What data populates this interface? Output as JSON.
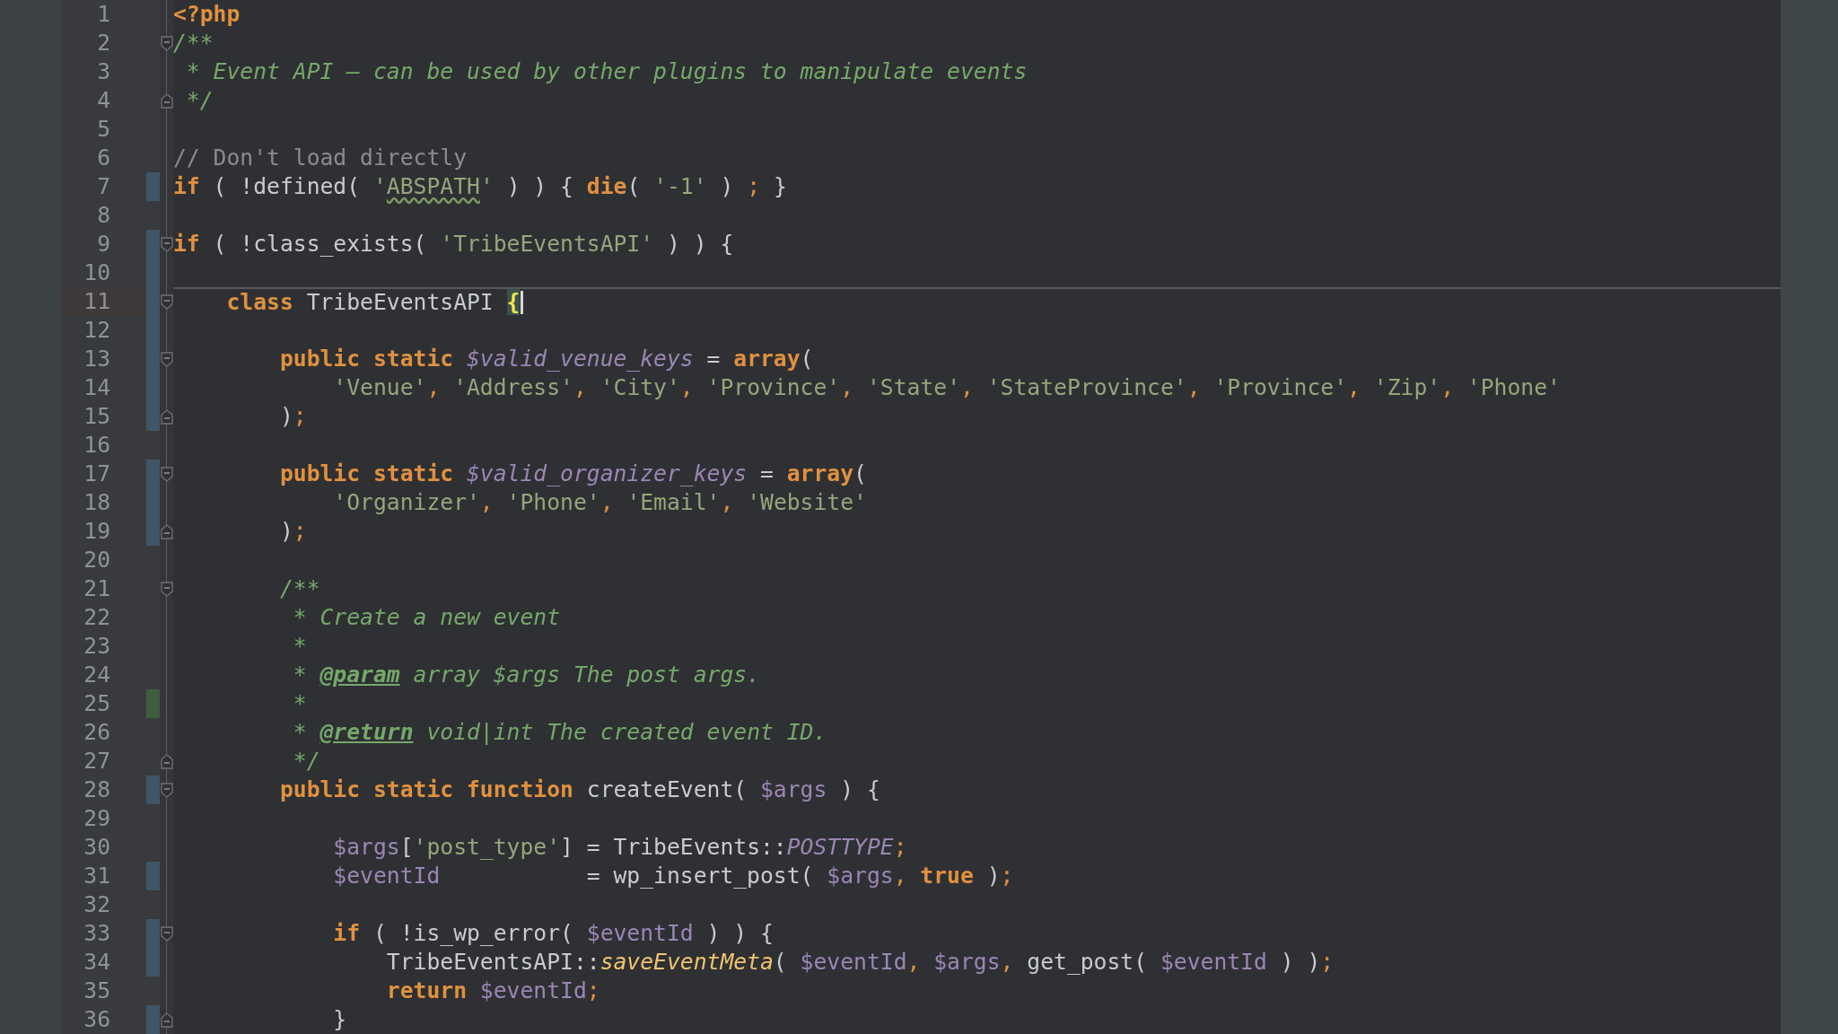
{
  "editor": {
    "lines": [
      {
        "number": "1",
        "tokens": [
          {
            "kind": "kw",
            "text": "<?php"
          }
        ]
      },
      {
        "number": "2",
        "fold_start": true,
        "tokens": [
          {
            "kind": "doc",
            "text": "/**"
          }
        ]
      },
      {
        "number": "3",
        "tokens": [
          {
            "kind": "doc",
            "text": " * Event API – can be used by other plugins to manipulate events"
          }
        ]
      },
      {
        "number": "4",
        "fold_end": true,
        "tokens": [
          {
            "kind": "doc",
            "text": " */"
          }
        ]
      },
      {
        "number": "5"
      },
      {
        "number": "6",
        "tokens": [
          {
            "kind": "comment",
            "text": "// Don't load directly"
          }
        ]
      },
      {
        "number": "7",
        "modified": true,
        "tokens": [
          {
            "kind": "kw",
            "text": "if"
          },
          {
            "kind": "text",
            "text": " ( !defined( "
          },
          {
            "kind": "str",
            "text": "'"
          },
          {
            "kind": "strwarn",
            "text": "ABSPATH"
          },
          {
            "kind": "str",
            "text": "'"
          },
          {
            "kind": "text",
            "text": " ) ) { "
          },
          {
            "kind": "kw",
            "text": "die"
          },
          {
            "kind": "text",
            "text": "( "
          },
          {
            "kind": "str",
            "text": "'-1'"
          },
          {
            "kind": "text",
            "text": " ) "
          },
          {
            "kind": "punct",
            "text": ";"
          },
          {
            "kind": "text",
            "text": " }"
          }
        ]
      },
      {
        "number": "8"
      },
      {
        "number": "9",
        "modified": true,
        "fold_start": true,
        "tokens": [
          {
            "kind": "kw",
            "text": "if"
          },
          {
            "kind": "text",
            "text": " ( !class_exists( "
          },
          {
            "kind": "str",
            "text": "'TribeEventsAPI'"
          },
          {
            "kind": "text",
            "text": " ) ) {"
          }
        ]
      },
      {
        "number": "10",
        "modified": true
      },
      {
        "number": "11",
        "modified": true,
        "fold_start": true,
        "current": true,
        "tokens": [
          {
            "kind": "kw",
            "text": "    class"
          },
          {
            "kind": "text",
            "text": " TribeEventsAPI "
          },
          {
            "kind": "brace",
            "text": "{"
          }
        ]
      },
      {
        "number": "12",
        "modified": true
      },
      {
        "number": "13",
        "modified": true,
        "fold_start": true,
        "tokens": [
          {
            "kind": "kw",
            "text": "        public static"
          },
          {
            "kind": "svar",
            "text": " $valid_venue_keys"
          },
          {
            "kind": "text",
            "text": " = "
          },
          {
            "kind": "kw",
            "text": "array"
          },
          {
            "kind": "text",
            "text": "("
          }
        ]
      },
      {
        "number": "14",
        "modified": true,
        "tokens": [
          {
            "kind": "str",
            "text": "            'Venue'"
          },
          {
            "kind": "punct",
            "text": ", "
          },
          {
            "kind": "str",
            "text": "'Address'"
          },
          {
            "kind": "punct",
            "text": ", "
          },
          {
            "kind": "str",
            "text": "'City'"
          },
          {
            "kind": "punct",
            "text": ", "
          },
          {
            "kind": "str",
            "text": "'Province'"
          },
          {
            "kind": "punct",
            "text": ", "
          },
          {
            "kind": "str",
            "text": "'State'"
          },
          {
            "kind": "punct",
            "text": ", "
          },
          {
            "kind": "str",
            "text": "'StateProvince'"
          },
          {
            "kind": "punct",
            "text": ", "
          },
          {
            "kind": "str",
            "text": "'Province'"
          },
          {
            "kind": "punct",
            "text": ", "
          },
          {
            "kind": "str",
            "text": "'Zip'"
          },
          {
            "kind": "punct",
            "text": ", "
          },
          {
            "kind": "str",
            "text": "'Phone'"
          }
        ]
      },
      {
        "number": "15",
        "modified": true,
        "fold_end": true,
        "tokens": [
          {
            "kind": "text",
            "text": "        )"
          },
          {
            "kind": "punct",
            "text": ";"
          }
        ]
      },
      {
        "number": "16"
      },
      {
        "number": "17",
        "modified": true,
        "fold_start": true,
        "tokens": [
          {
            "kind": "kw",
            "text": "        public static"
          },
          {
            "kind": "svar",
            "text": " $valid_organizer_keys"
          },
          {
            "kind": "text",
            "text": " = "
          },
          {
            "kind": "kw",
            "text": "array"
          },
          {
            "kind": "text",
            "text": "("
          }
        ]
      },
      {
        "number": "18",
        "modified": true,
        "tokens": [
          {
            "kind": "str",
            "text": "            'Organizer'"
          },
          {
            "kind": "punct",
            "text": ", "
          },
          {
            "kind": "str",
            "text": "'Phone'"
          },
          {
            "kind": "punct",
            "text": ", "
          },
          {
            "kind": "str",
            "text": "'Email'"
          },
          {
            "kind": "punct",
            "text": ", "
          },
          {
            "kind": "str",
            "text": "'Website'"
          }
        ]
      },
      {
        "number": "19",
        "modified": true,
        "fold_end": true,
        "tokens": [
          {
            "kind": "text",
            "text": "        )"
          },
          {
            "kind": "punct",
            "text": ";"
          }
        ]
      },
      {
        "number": "20"
      },
      {
        "number": "21",
        "fold_start": true,
        "tokens": [
          {
            "kind": "doc",
            "text": "        /**"
          }
        ]
      },
      {
        "number": "22",
        "tokens": [
          {
            "kind": "doc",
            "text": "         * Create a new event"
          }
        ]
      },
      {
        "number": "23",
        "tokens": [
          {
            "kind": "doc",
            "text": "         *"
          }
        ]
      },
      {
        "number": "24",
        "tokens": [
          {
            "kind": "doc",
            "text": "         * "
          },
          {
            "kind": "doctag",
            "text": "@param"
          },
          {
            "kind": "doc",
            "text": " array $args The post args."
          }
        ]
      },
      {
        "number": "25",
        "added": true,
        "tokens": [
          {
            "kind": "doc",
            "text": "         *"
          }
        ]
      },
      {
        "number": "26",
        "tokens": [
          {
            "kind": "doc",
            "text": "         * "
          },
          {
            "kind": "doctag",
            "text": "@return"
          },
          {
            "kind": "doc",
            "text": " void|int The created event ID."
          }
        ]
      },
      {
        "number": "27",
        "fold_end": true,
        "tokens": [
          {
            "kind": "doc",
            "text": "         */"
          }
        ]
      },
      {
        "number": "28",
        "modified": true,
        "fold_start": true,
        "tokens": [
          {
            "kind": "kw",
            "text": "        public static function"
          },
          {
            "kind": "text",
            "text": " createEvent( "
          },
          {
            "kind": "var",
            "text": "$args"
          },
          {
            "kind": "text",
            "text": " ) {"
          }
        ]
      },
      {
        "number": "29"
      },
      {
        "number": "30",
        "tokens": [
          {
            "kind": "var",
            "text": "            $args"
          },
          {
            "kind": "text",
            "text": "["
          },
          {
            "kind": "str",
            "text": "'post_type'"
          },
          {
            "kind": "text",
            "text": "] = TribeEvents::"
          },
          {
            "kind": "const",
            "text": "POSTTYPE"
          },
          {
            "kind": "punct",
            "text": ";"
          }
        ]
      },
      {
        "number": "31",
        "modified": true,
        "tokens": [
          {
            "kind": "var",
            "text": "            $eventId"
          },
          {
            "kind": "text",
            "text": "           = wp_insert_post( "
          },
          {
            "kind": "var",
            "text": "$args"
          },
          {
            "kind": "punct",
            "text": ", "
          },
          {
            "kind": "kw",
            "text": "true"
          },
          {
            "kind": "text",
            "text": " )"
          },
          {
            "kind": "punct",
            "text": ";"
          }
        ]
      },
      {
        "number": "32"
      },
      {
        "number": "33",
        "modified": true,
        "fold_start": true,
        "tokens": [
          {
            "kind": "kw",
            "text": "            if"
          },
          {
            "kind": "text",
            "text": " ( !is_wp_error( "
          },
          {
            "kind": "var",
            "text": "$eventId"
          },
          {
            "kind": "text",
            "text": " ) ) {"
          }
        ]
      },
      {
        "number": "34",
        "modified": true,
        "tokens": [
          {
            "kind": "text",
            "text": "                TribeEventsAPI::"
          },
          {
            "kind": "scall",
            "text": "saveEventMeta"
          },
          {
            "kind": "text",
            "text": "( "
          },
          {
            "kind": "var",
            "text": "$eventId"
          },
          {
            "kind": "punct",
            "text": ", "
          },
          {
            "kind": "var",
            "text": "$args"
          },
          {
            "kind": "punct",
            "text": ", "
          },
          {
            "kind": "text",
            "text": "get_post( "
          },
          {
            "kind": "var",
            "text": "$eventId"
          },
          {
            "kind": "text",
            "text": " ) )"
          },
          {
            "kind": "punct",
            "text": ";"
          }
        ]
      },
      {
        "number": "35",
        "tokens": [
          {
            "kind": "kw",
            "text": "                return"
          },
          {
            "kind": "var",
            "text": " $eventId"
          },
          {
            "kind": "punct",
            "text": ";"
          }
        ]
      },
      {
        "number": "36",
        "modified": true,
        "fold_end": true,
        "tokens": [
          {
            "kind": "text",
            "text": "            }"
          }
        ]
      }
    ]
  }
}
